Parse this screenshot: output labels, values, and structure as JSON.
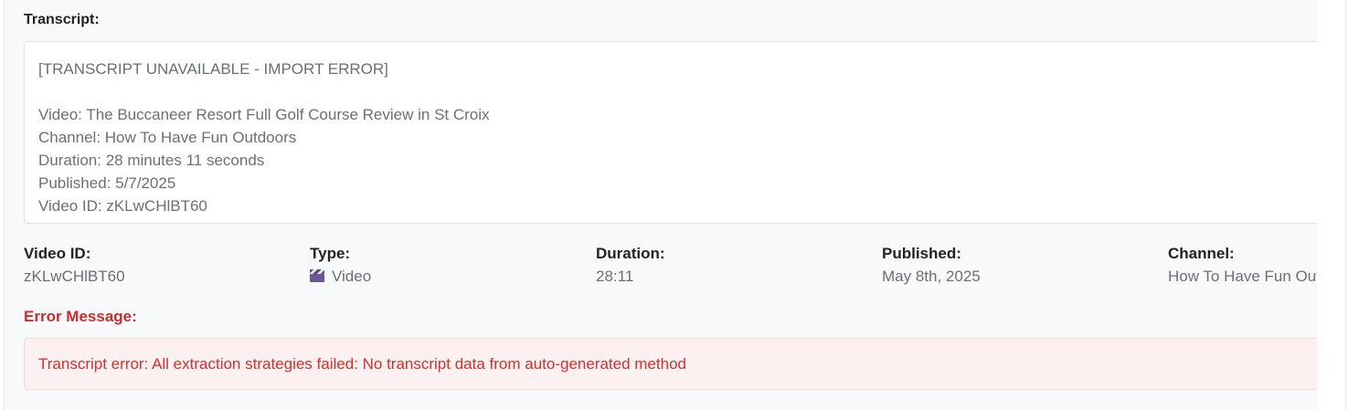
{
  "transcript": {
    "label": "Transcript:",
    "header": "[TRANSCRIPT UNAVAILABLE - IMPORT ERROR]",
    "lines": [
      "Video: The Buccaneer Resort Full Golf Course Review in St  Croix",
      "Channel: How To Have Fun Outdoors",
      "Duration: 28 minutes 11 seconds",
      "Published: 5/7/2025",
      "Video ID: zKLwCHlBT60"
    ]
  },
  "meta": {
    "video_id": {
      "label": "Video ID:",
      "value": "zKLwCHlBT60"
    },
    "type": {
      "label": "Type:",
      "value": "Video",
      "icon": "clapperboard-icon"
    },
    "duration": {
      "label": "Duration:",
      "value": "28:11"
    },
    "published": {
      "label": "Published:",
      "value": "May 8th, 2025"
    },
    "channel": {
      "label": "Channel:",
      "value": "How To Have Fun Outdoors"
    }
  },
  "error": {
    "label": "Error Message:",
    "message": "Transcript error: All extraction strategies failed: No transcript data from auto-generated method"
  },
  "colors": {
    "panel_bg": "#f8f9fa",
    "error_text": "#d0312d",
    "error_bg": "#fdf0f0",
    "muted_text": "#6b6f75"
  }
}
